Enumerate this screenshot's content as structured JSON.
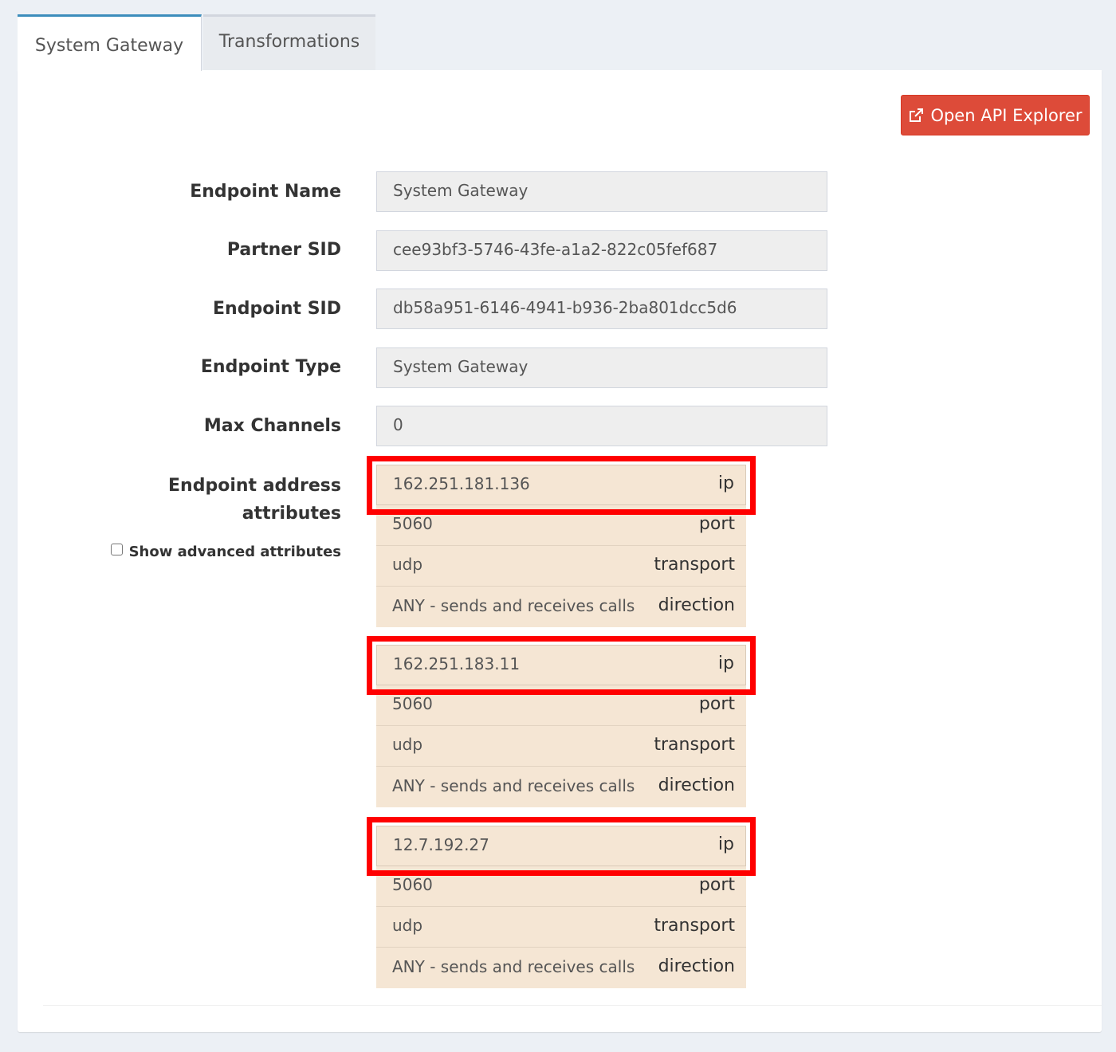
{
  "tabs": [
    {
      "label": "System Gateway"
    },
    {
      "label": "Transformations"
    }
  ],
  "toolbar": {
    "api_button_label": "Open API Explorer"
  },
  "form": {
    "endpoint_name": {
      "label": "Endpoint Name",
      "value": "System Gateway"
    },
    "partner_sid": {
      "label": "Partner SID",
      "value": "cee93bf3-5746-43fe-a1a2-822c05fef687"
    },
    "endpoint_sid": {
      "label": "Endpoint SID",
      "value": "db58a951-6146-4941-b936-2ba801dcc5d6"
    },
    "endpoint_type": {
      "label": "Endpoint Type",
      "value": "System Gateway"
    },
    "max_channels": {
      "label": "Max Channels",
      "value": "0"
    },
    "address_attributes": {
      "label_line1": "Endpoint address",
      "label_line2": "attributes",
      "show_advanced_label": "Show advanced attributes",
      "groups": [
        {
          "ip": "162.251.181.136",
          "port": "5060",
          "transport": "udp",
          "direction": "ANY - sends and receives calls"
        },
        {
          "ip": "162.251.183.11",
          "port": "5060",
          "transport": "udp",
          "direction": "ANY - sends and receives calls"
        },
        {
          "ip": "12.7.192.27",
          "port": "5060",
          "transport": "udp",
          "direction": "ANY - sends and receives calls"
        }
      ],
      "keys": {
        "ip": "ip",
        "port": "port",
        "transport": "transport",
        "direction": "direction"
      }
    }
  },
  "colors": {
    "accent": "#3c8dbc",
    "danger": "#dd4b39",
    "highlight": "#ff0000",
    "attribute_bg": "#f5e6d4"
  }
}
